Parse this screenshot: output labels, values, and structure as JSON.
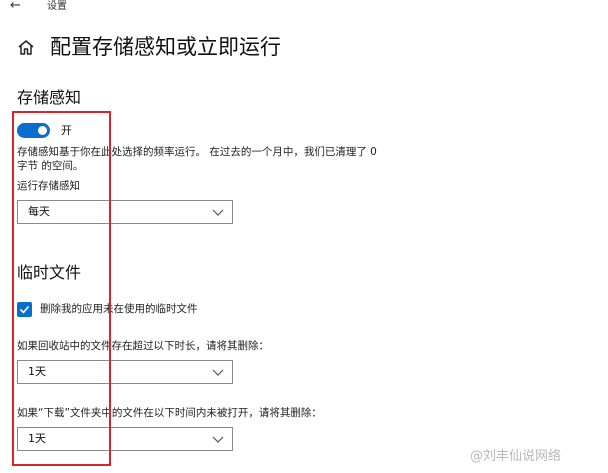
{
  "window": {
    "back_glyph": "←",
    "title": "设置"
  },
  "header": {
    "home_icon": "home-icon",
    "title": "配置存储感知或立即运行"
  },
  "storage_sense": {
    "section_title": "存储感知",
    "toggle_on": true,
    "toggle_label": "开",
    "description": "存储感知基于你在此处选择的频率运行。 在过去的一个月中，我们已清理了 0 字节 的空间。",
    "run_label": "运行存储感知",
    "run_value": "每天"
  },
  "temp_files": {
    "section_title": "临时文件",
    "delete_checkbox_checked": true,
    "delete_checkbox_label": "删除我的应用未在使用的临时文件",
    "recycle_label": "如果回收站中的文件存在超过以下时长，请将其删除：",
    "recycle_value": "1天",
    "download_label": "如果“下载”文件夹中的文件在以下时间内未被打开，请将其删除：",
    "download_value": "1天"
  },
  "watermark": "@刘丰仙说网络",
  "colors": {
    "accent": "#0a6ed1",
    "highlight": "#d7262a"
  }
}
